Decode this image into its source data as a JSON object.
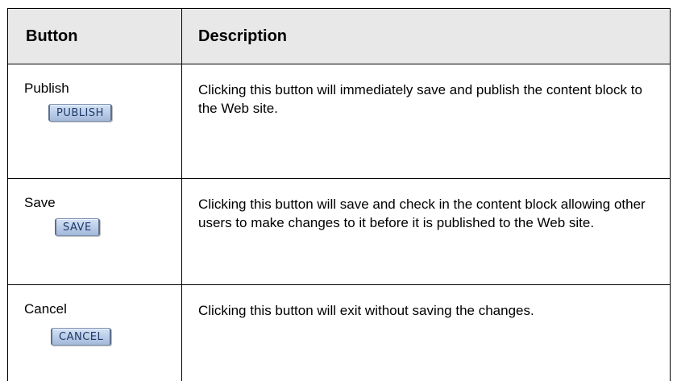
{
  "table": {
    "headers": {
      "button": "Button",
      "description": "Description"
    },
    "rows": [
      {
        "name": "Publish",
        "button_label": "PUBLISH",
        "description": "Clicking this button will immediately save and publish the content block to the Web site."
      },
      {
        "name": "Save",
        "button_label": "SAVE",
        "description": "Clicking this button will save and check in the content block allowing other users to make changes to it before it is published to the Web site."
      },
      {
        "name": "Cancel",
        "button_label": "CANCEL",
        "description": "Clicking this button will exit without saving the changes."
      }
    ]
  },
  "colors": {
    "header_background": "#e8e8e8",
    "button_face": "#b8cbe8",
    "button_text": "#1c3a6a"
  }
}
